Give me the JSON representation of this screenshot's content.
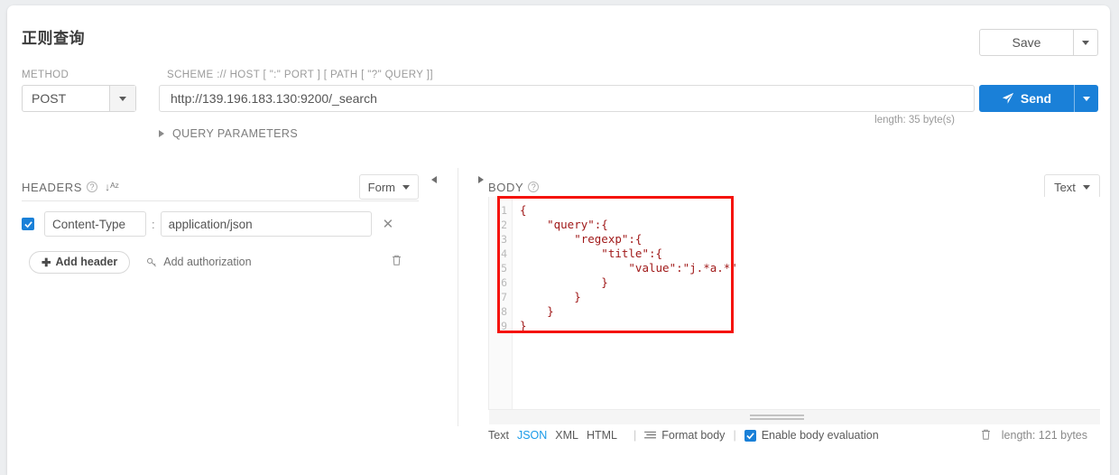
{
  "title": "正则查询",
  "request": {
    "method_label": "METHOD",
    "method_value": "POST",
    "url_label": "SCHEME :// HOST [ \":\" PORT ] [ PATH [ \"?\" QUERY ]]",
    "url_value": "http://139.196.183.130:9200/_search",
    "url_placeholder": "http://",
    "length_note": "length: 35 byte(s)",
    "query_parameters_label": "QUERY PARAMETERS"
  },
  "actions": {
    "save_label": "Save",
    "send_label": "Send"
  },
  "headers_pane": {
    "title": "HEADERS",
    "view_mode": "Form",
    "rows": [
      {
        "enabled": true,
        "key": "Content-Type",
        "value": "application/json"
      }
    ],
    "add_header_label": "Add header",
    "add_authorization_label": "Add authorization"
  },
  "body_pane": {
    "title": "BODY",
    "view_mode": "Text",
    "line_numbers": [
      "1",
      "2",
      "3",
      "4",
      "5",
      "6",
      "7",
      "8",
      "9"
    ],
    "code_lines": [
      "{",
      "    \"query\":{",
      "        \"regexp\":{",
      "            \"title\":{",
      "                \"value\":\"j.*a.*\"",
      "            }",
      "        }",
      "    }",
      "}"
    ],
    "formats": [
      {
        "label": "Text",
        "active": false
      },
      {
        "label": "JSON",
        "active": true
      },
      {
        "label": "XML",
        "active": false
      },
      {
        "label": "HTML",
        "active": false
      }
    ],
    "format_body_label": "Format body",
    "enable_evaluation_label": "Enable body evaluation",
    "enable_evaluation_checked": true,
    "length_note": "length: 121 bytes"
  },
  "colors": {
    "accent": "#1a80d8",
    "json_active": "#1a9ae8",
    "code": "#a01919",
    "annotation": "#f5130b"
  }
}
